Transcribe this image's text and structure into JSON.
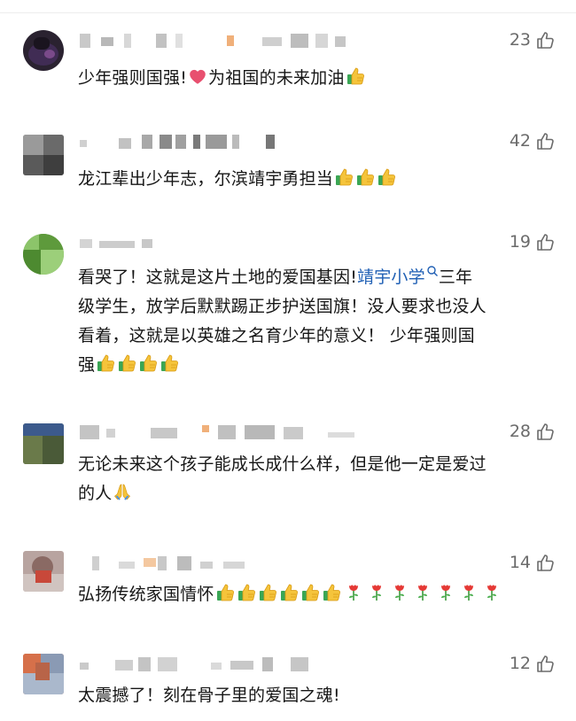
{
  "comments": [
    {
      "likes": "23",
      "text_before": "少年强则国强!",
      "text_mid": "为祖国的未来加油"
    },
    {
      "likes": "42",
      "text": "龙江辈出少年志，尔滨靖宇勇担当"
    },
    {
      "likes": "19",
      "line1_before": "看哭了！这就是这片土地的爱国基因!",
      "link": "靖宇小学",
      "line1_after": "三年",
      "line2": "级学生，放学后默默踢正步护送国旗！没人要求也没人",
      "line3": "看着，这就是以英雄之名育少年的意义！ 少年强则国",
      "line4": "强"
    },
    {
      "likes": "28",
      "line1": "无论未来这个孩子能成长成什么样，但是他一定是爱过",
      "line2": "的人"
    },
    {
      "likes": "14",
      "text": "弘扬传统家国情怀"
    },
    {
      "likes": "12",
      "text": "太震撼了！刻在骨子里的爱国之魂!"
    }
  ],
  "icons": {
    "like": "thumbs-up-outline-icon",
    "heart": "heart-icon",
    "thumbs": "thumbs-up-emoji-icon",
    "pray": "folded-hands-icon",
    "rose": "rose-icon",
    "search": "search-icon"
  },
  "colors": {
    "link": "#1f5fb4",
    "count": "#6b6b6b"
  }
}
